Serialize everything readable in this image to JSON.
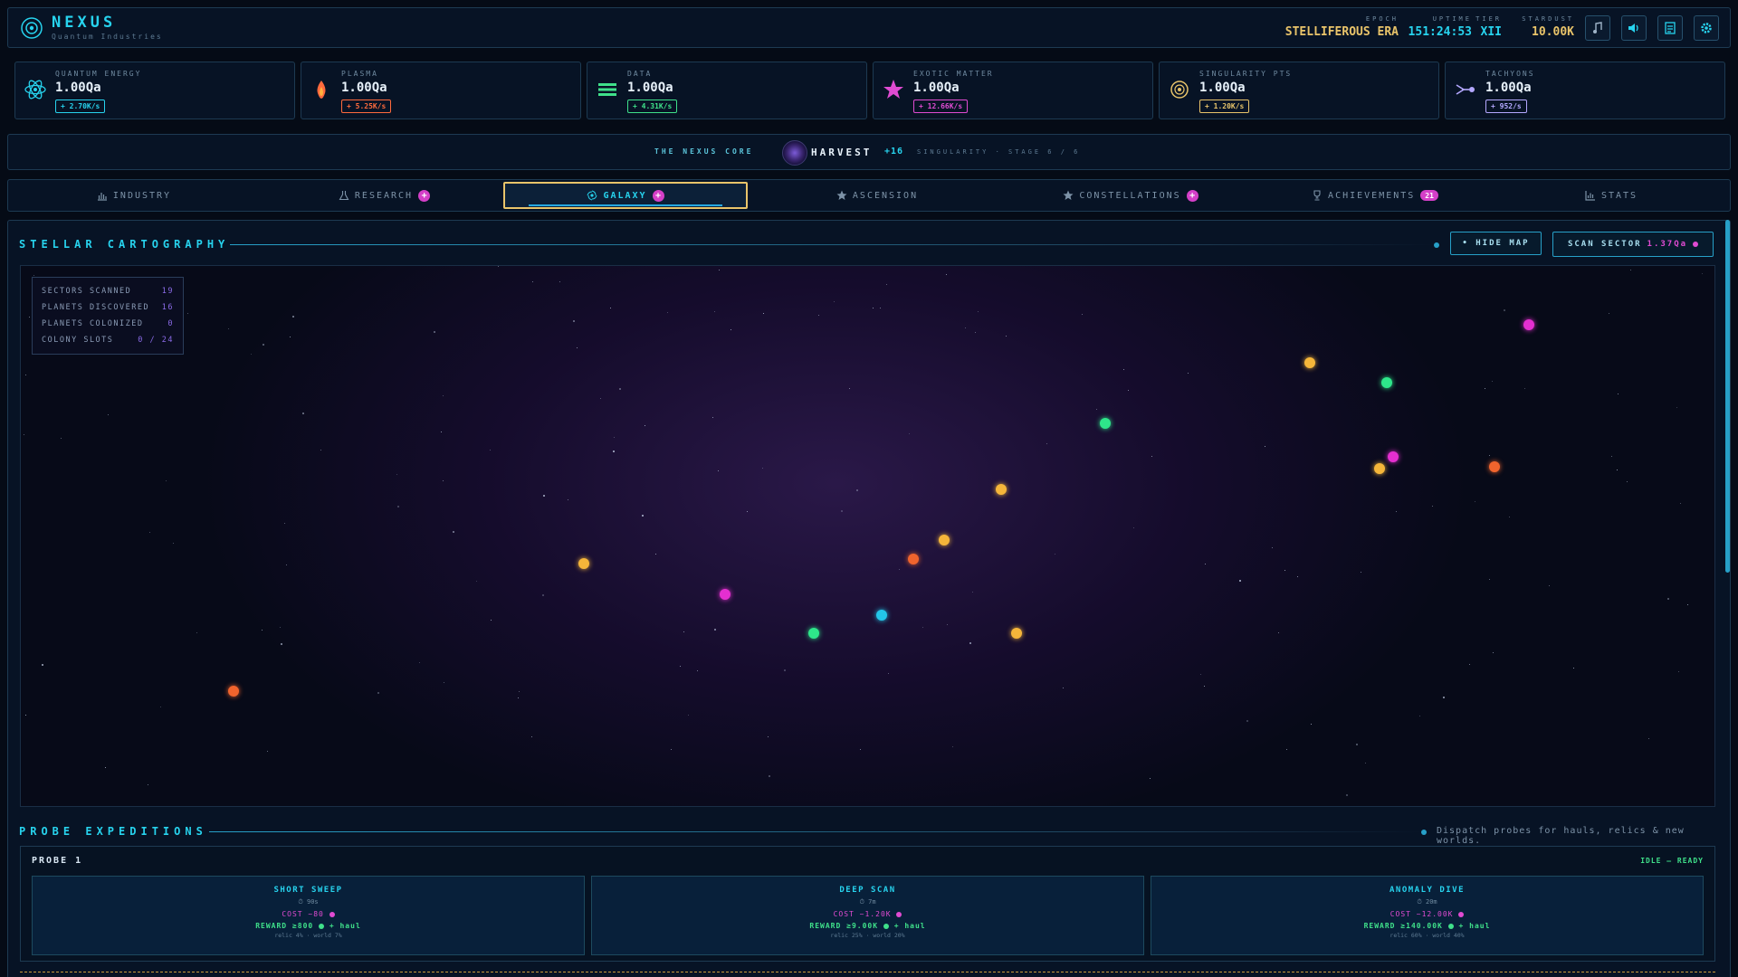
{
  "header": {
    "title": "NEXUS",
    "subtitle": "Quantum Industries",
    "epoch_label": "EPOCH",
    "epoch_value": "STELLIFEROUS ERA",
    "uptime_label": "UPTIME",
    "uptime_value": "151:24:53",
    "tier_label": "TIER",
    "tier_value": "XII",
    "stardust_label": "STARDUST",
    "stardust_value": "10.00K",
    "buttons": [
      "music-icon",
      "volume-icon",
      "log-icon",
      "gear-icon"
    ]
  },
  "resources": [
    {
      "label": "QUANTUM ENERGY",
      "value": "1.00Qa",
      "rate": "+ 2.70K/s",
      "icon": "atom-icon",
      "color": "#27d3ee"
    },
    {
      "label": "PLASMA",
      "value": "1.00Qa",
      "rate": "+ 5.25K/s",
      "icon": "flame-icon",
      "color": "#ff6a3d"
    },
    {
      "label": "DATA",
      "value": "1.00Qa",
      "rate": "+ 4.31K/s",
      "icon": "data-icon",
      "color": "#3fe08a"
    },
    {
      "label": "EXOTIC MATTER",
      "value": "1.00Qa",
      "rate": "+ 12.66K/s",
      "icon": "star-icon",
      "color": "#e04bd2"
    },
    {
      "label": "SINGULARITY PTS",
      "value": "1.00Qa",
      "rate": "+ 1.20K/s",
      "icon": "singularity-icon",
      "color": "#e9c46a"
    },
    {
      "label": "TACHYONS",
      "value": "1.00Qa",
      "rate": "+ 952/s",
      "icon": "tachyon-icon",
      "color": "#b4a8ff"
    }
  ],
  "core": {
    "label": "THE NEXUS CORE",
    "harvest": "HARVEST",
    "harvest_bonus": "+16",
    "stage": "SINGULARITY · STAGE 6 / 6"
  },
  "tabs": [
    {
      "label": "INDUSTRY",
      "icon": "bar-chart-icon",
      "badge": ""
    },
    {
      "label": "RESEARCH",
      "icon": "flask-icon",
      "badge": "+"
    },
    {
      "label": "GALAXY",
      "icon": "galaxy-icon",
      "badge": "+",
      "active": true
    },
    {
      "label": "ASCENSION",
      "icon": "star-icon",
      "badge": ""
    },
    {
      "label": "CONSTELLATIONS",
      "icon": "star-icon",
      "badge": "+"
    },
    {
      "label": "ACHIEVEMENTS",
      "icon": "trophy-icon",
      "badge": "21"
    },
    {
      "label": "STATS",
      "icon": "stats-icon",
      "badge": ""
    }
  ],
  "cartography": {
    "title": "STELLAR CARTOGRAPHY",
    "hide_map": "• HIDE MAP",
    "scan_label": "SCAN SECTOR",
    "scan_cost": "1.37Qa",
    "legend": [
      {
        "label": "SECTORS SCANNED",
        "value": "19"
      },
      {
        "label": "PLANETS DISCOVERED",
        "value": "16"
      },
      {
        "label": "PLANETS COLONIZED",
        "value": "0"
      },
      {
        "label": "COLONY SLOTS",
        "value": "0 / 24"
      }
    ],
    "planet_colors": {
      "gold": "#f5b63a",
      "green": "#2ee68a",
      "magenta": "#e42fd0",
      "orange": "#f0642d",
      "cyan": "#23c6e8"
    }
  },
  "expeditions": {
    "title": "PROBE EXPEDITIONS",
    "hint": "Dispatch probes for hauls, relics & new worlds.",
    "probe_name": "PROBE 1",
    "probe_status": "IDLE — READY",
    "missions": [
      {
        "name": "SHORT SWEEP",
        "time": "⏱ 90s",
        "cost": "COST ~80",
        "reward": "REWARD ≥800",
        "haul": "+ haul",
        "relic": "relic 4% · world 7%"
      },
      {
        "name": "DEEP SCAN",
        "time": "⏱ 7m",
        "cost": "COST ~1.20K",
        "reward": "REWARD ≥9.00K",
        "haul": "+ haul",
        "relic": "relic 25% · world 20%"
      },
      {
        "name": "ANOMALY DIVE",
        "time": "⏱ 20m",
        "cost": "COST ~12.00K",
        "reward": "REWARD ≥140.00K",
        "haul": "+ haul",
        "relic": "relic 60% · world 40%"
      }
    ]
  }
}
